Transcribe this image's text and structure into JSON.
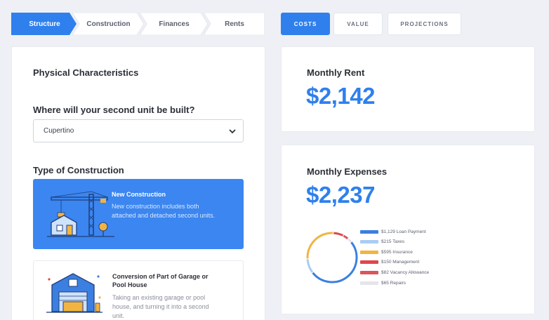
{
  "steps": [
    {
      "label": "Structure",
      "active": true
    },
    {
      "label": "Construction",
      "active": false
    },
    {
      "label": "Finances",
      "active": false
    },
    {
      "label": "Rents",
      "active": false
    }
  ],
  "tabs": [
    {
      "label": "COSTS",
      "active": true
    },
    {
      "label": "VALUE",
      "active": false
    },
    {
      "label": "PROJECTIONS",
      "active": false
    }
  ],
  "left": {
    "section_title": "Physical Characteristics",
    "question": "Where will your second unit be built?",
    "location_value": "Cupertino",
    "type_title": "Type of Construction",
    "options": [
      {
        "title": "New Construction",
        "desc_lines": [
          "New construction includes both",
          "attached and detached second units."
        ],
        "icon": "crane-house-icon"
      },
      {
        "title_lines": [
          "Conversion of Part of Garage or",
          "Pool House"
        ],
        "desc_lines": [
          "Taking an existing garage or pool",
          "house, and turning it into a second",
          "unit."
        ],
        "icon": "garage-conversion-icon"
      }
    ]
  },
  "rent": {
    "title": "Monthly Rent",
    "value": "$2,142"
  },
  "expenses": {
    "title": "Monthly Expenses",
    "value": "$2,237",
    "legend": [
      {
        "label": "$1,129 Loan Payment",
        "color": "#3b7fe0",
        "amount": 1129
      },
      {
        "label": "$215 Taxes",
        "color": "#a9cdf4",
        "amount": 215
      },
      {
        "label": "$595 Insurance",
        "color": "#f2b441",
        "amount": 595
      },
      {
        "label": "$150 Management",
        "color": "#e0474c",
        "amount": 150
      },
      {
        "label": "$82 Vacancy Allowance",
        "color": "#d9565a",
        "amount": 82
      },
      {
        "label": "$65 Repairs",
        "color": "#e3e5ea",
        "amount": 65
      }
    ]
  }
}
